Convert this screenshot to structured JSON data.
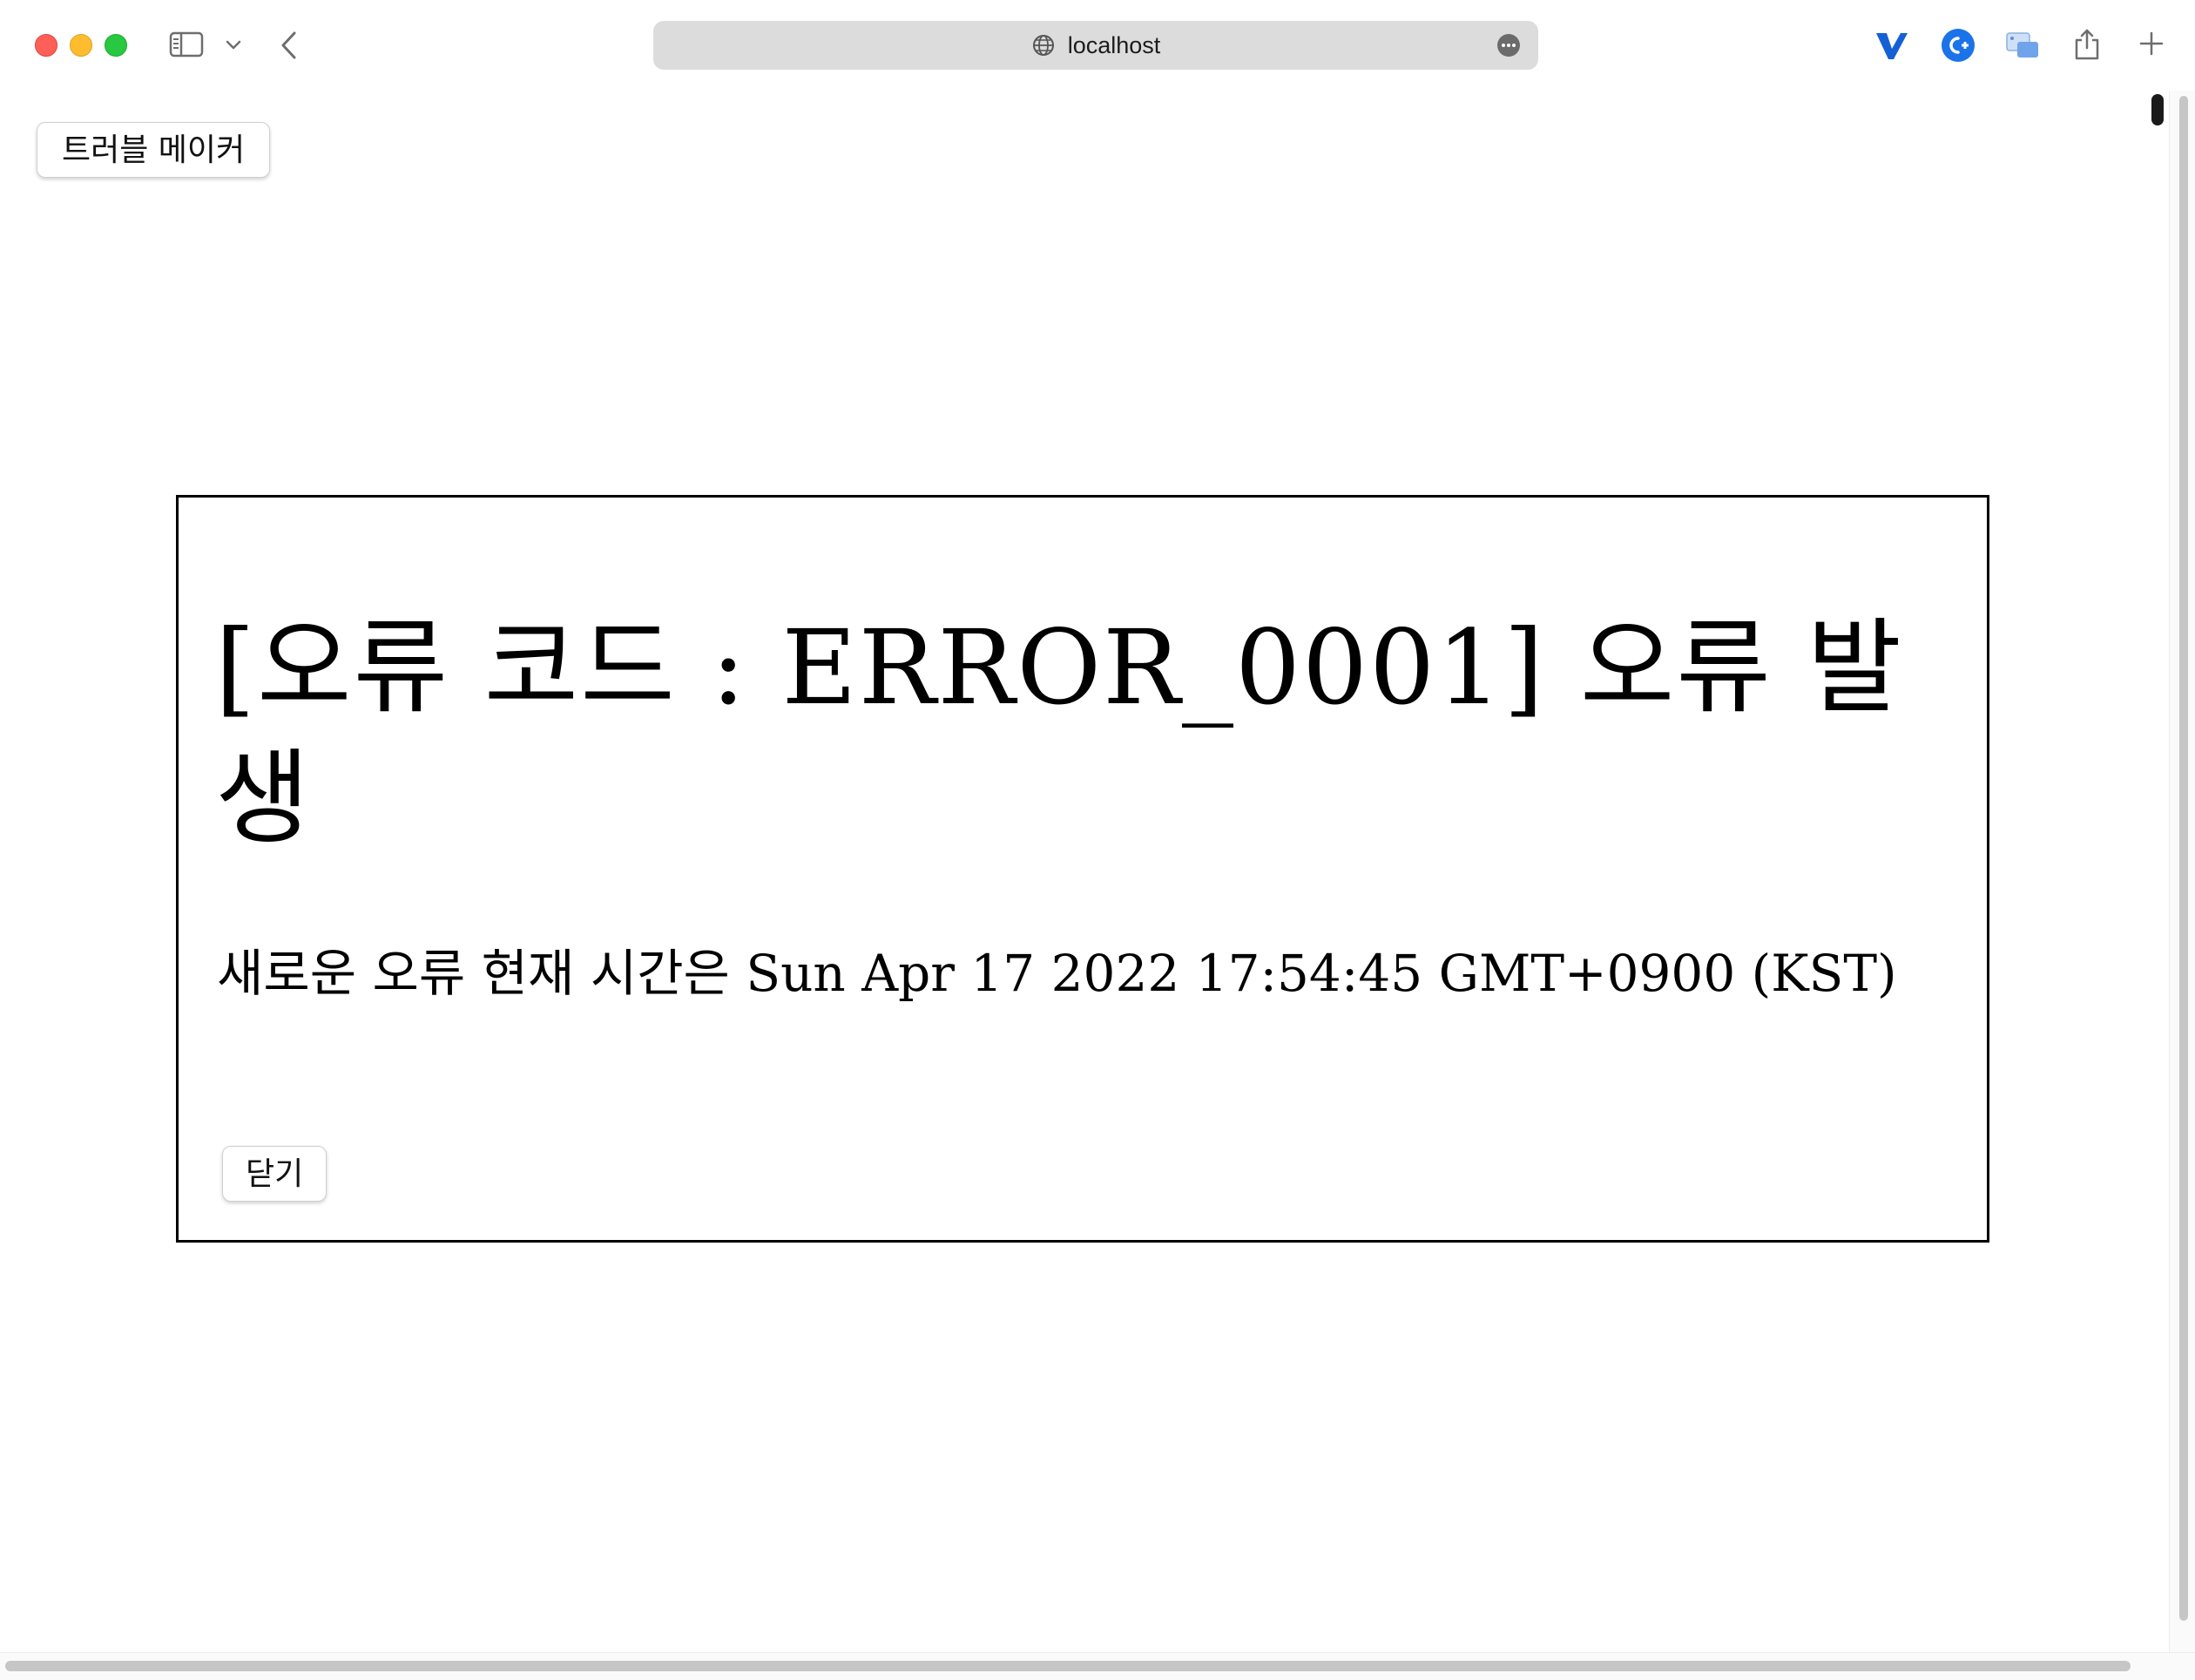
{
  "browser": {
    "url": "localhost",
    "icons": {
      "sidebar": "sidebar-icon",
      "chevron": "chevron-down-icon",
      "back": "chevron-left-icon",
      "site": "globe-icon",
      "more": "ellipsis-icon",
      "extension_1": "v-extension-icon",
      "extension_2": "c-plus-extension-icon",
      "extension_3": "picture-in-picture-icon",
      "share": "share-icon",
      "new_tab": "plus-icon"
    },
    "colors": {
      "close": "#fe5f57",
      "minimize": "#febc2e",
      "maximize": "#28c840",
      "address_bar": "#dcdcdc"
    }
  },
  "page": {
    "trouble_button_label": "트러블 메이커"
  },
  "dialog": {
    "title": "[오류 코드 : ERROR_0001] 오류 발생",
    "message": "새로운 오류 현재 시간은 Sun Apr 17 2022 17:54:45 GMT+0900 (KST)",
    "close_button_label": "닫기"
  }
}
